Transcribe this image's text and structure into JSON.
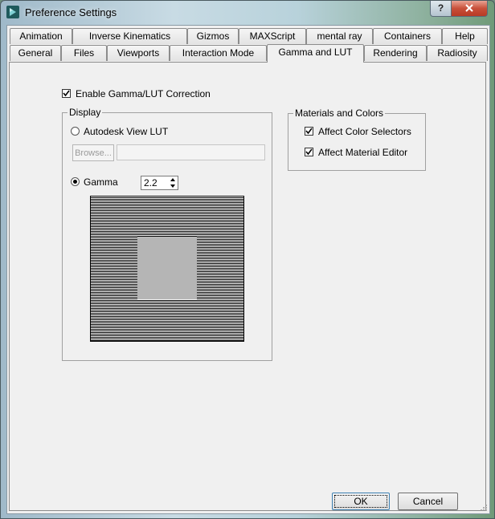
{
  "window": {
    "title": "Preference Settings",
    "help_label": "?",
    "close_label": "X"
  },
  "tabs_row1": [
    {
      "label": "Animation"
    },
    {
      "label": "Inverse Kinematics"
    },
    {
      "label": "Gizmos"
    },
    {
      "label": "MAXScript"
    },
    {
      "label": "mental ray"
    },
    {
      "label": "Containers"
    },
    {
      "label": "Help"
    }
  ],
  "tabs_row2": [
    {
      "label": "General"
    },
    {
      "label": "Files"
    },
    {
      "label": "Viewports"
    },
    {
      "label": "Interaction Mode"
    },
    {
      "label": "Gamma and LUT",
      "active": true
    },
    {
      "label": "Rendering"
    },
    {
      "label": "Radiosity"
    }
  ],
  "gamma_lut": {
    "enable_label": "Enable Gamma/LUT Correction",
    "enable_checked": true,
    "display": {
      "group_label": "Display",
      "lut_label": "Autodesk View LUT",
      "lut_selected": false,
      "browse_label": "Browse...",
      "path_value": "",
      "gamma_label": "Gamma",
      "gamma_selected": true,
      "gamma_value": "2.2"
    },
    "materials": {
      "group_label": "Materials and Colors",
      "color_selectors_label": "Affect Color Selectors",
      "color_selectors_checked": true,
      "material_editor_label": "Affect Material Editor",
      "material_editor_checked": true
    }
  },
  "buttons": {
    "ok_label": "OK",
    "cancel_label": "Cancel"
  },
  "colors": {
    "dialog_bg": "#f0f0f0",
    "close_red": "#c8503a",
    "gamma_gray": "#b5b5b5"
  }
}
